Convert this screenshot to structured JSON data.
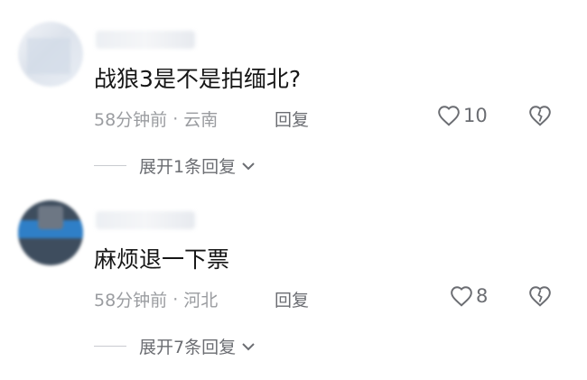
{
  "comments": [
    {
      "text": "战狼3是不是拍缅北?",
      "time": "58分钟前",
      "location": "云南",
      "reply_label": "回复",
      "likes": "10",
      "expand_label": "展开1条回复"
    },
    {
      "text": "麻烦退一下票",
      "time": "58分钟前",
      "location": "河北",
      "reply_label": "回复",
      "likes": "8",
      "expand_label": "展开7条回复"
    }
  ],
  "separator": "·",
  "colors": {
    "text": "#161616",
    "meta": "#9a9ca0",
    "action": "#6b6d72",
    "divider": "#c9cbd0"
  }
}
